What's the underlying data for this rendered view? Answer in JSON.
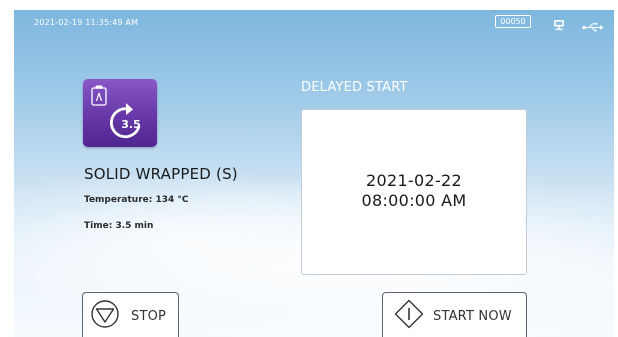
{
  "status_bar": {
    "datetime": "2021-02-19   11:35:49 AM",
    "cycle_counter": "00050",
    "icons": [
      "network-icon",
      "usb-icon"
    ]
  },
  "program": {
    "icon": "solid-wrapped-program-icon",
    "icon_value": "3.5",
    "name": "SOLID WRAPPED (S)",
    "temperature": "Temperature: 134 °C",
    "time": "Time: 3.5 min"
  },
  "delayed_start": {
    "title": "DELAYED START",
    "date": "2021-02-22",
    "time": "08:00:00 AM"
  },
  "buttons": {
    "stop_label": "STOP",
    "start_now_label": "START NOW"
  },
  "colors": {
    "program_icon": "#6a3aaa",
    "background_top": "#7eb7de",
    "background_bottom": "#f6fbff"
  }
}
